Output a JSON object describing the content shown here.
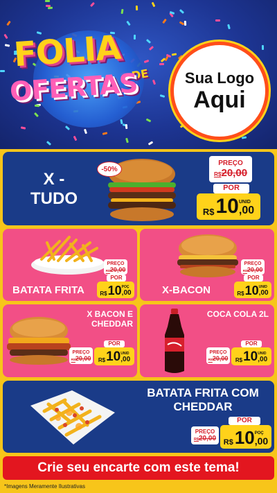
{
  "header": {
    "headline_line1": "FOLIA",
    "headline_de": "DE",
    "headline_line2": "OFERTAS",
    "logo_line1": "Sua Logo",
    "logo_line2": "Aqui"
  },
  "products": [
    {
      "name": "X - TUDO",
      "discount_badge": "-50%",
      "old_price_label": "PREÇO",
      "old_price_currency": "R$",
      "old_price": "20,00",
      "por_label": "POR",
      "currency": "R$",
      "price_int": "10",
      "price_dec": ",00",
      "unit": "UNID"
    },
    {
      "name": "BATATA FRITA",
      "old_price_label": "PREÇO",
      "old_price_currency": "R$",
      "old_price": "20,00",
      "por_label": "POR",
      "currency": "R$",
      "price_int": "10",
      "price_dec": ",00",
      "unit": "POÇ"
    },
    {
      "name": "X-BACON",
      "old_price_label": "PREÇO",
      "old_price_currency": "R$",
      "old_price": "20,00",
      "por_label": "POR",
      "currency": "R$",
      "price_int": "10",
      "price_dec": ",00",
      "unit": "UNID"
    },
    {
      "name": "X BACON E CHEDDAR",
      "old_price_label": "PREÇO",
      "old_price_currency": "R$",
      "old_price": "20,00",
      "por_label": "POR",
      "currency": "R$",
      "price_int": "10",
      "price_dec": ",00",
      "unit": "UNID"
    },
    {
      "name": "COCA COLA 2L",
      "old_price_label": "PREÇO",
      "old_price_currency": "R$",
      "old_price": "20,00",
      "por_label": "POR",
      "currency": "R$",
      "price_int": "10",
      "price_dec": ",00",
      "unit": "UNID"
    },
    {
      "name": "BATATA FRITA COM CHEDDAR",
      "old_price_label": "PREÇO",
      "old_price_currency": "R$",
      "old_price": "20,00",
      "por_label": "POR",
      "currency": "R$",
      "price_int": "10",
      "price_dec": ",00",
      "unit": "POÇ"
    }
  ],
  "cta": "Crie seu encarte com este tema!",
  "footnote": "*Imagens Meramente Ilustrativas",
  "colors": {
    "blue_panel": "#1a3b88",
    "pink_panel": "#f24f86",
    "price_yellow": "#ffd21a",
    "cta_red": "#e3161f",
    "page_yellow": "#f7c51a"
  }
}
